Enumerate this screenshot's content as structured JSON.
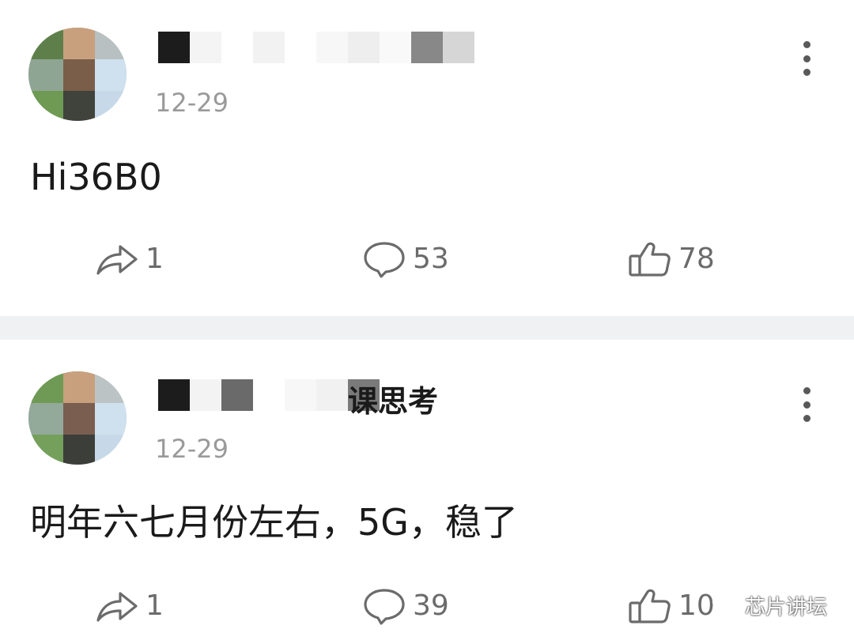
{
  "posts": [
    {
      "timestamp": "12-29",
      "content": "Hi36B0",
      "actions": {
        "share_count": "1",
        "comment_count": "53",
        "like_count": "78"
      }
    },
    {
      "username_visible": "课思考",
      "timestamp": "12-29",
      "content": "明年六七月份左右，5G，稳了",
      "actions": {
        "share_count": "1",
        "comment_count": "39",
        "like_count": "10"
      }
    }
  ],
  "watermark": {
    "label": "芯片讲坛"
  },
  "colors": {
    "text_primary": "#1a1a1a",
    "text_secondary": "#9a9a9a",
    "icon_gray": "#6b6b6b",
    "divider": "#f0f1f3"
  },
  "icons": [
    "share-icon",
    "comment-icon",
    "like-icon",
    "more-icon",
    "wechat-icon"
  ]
}
